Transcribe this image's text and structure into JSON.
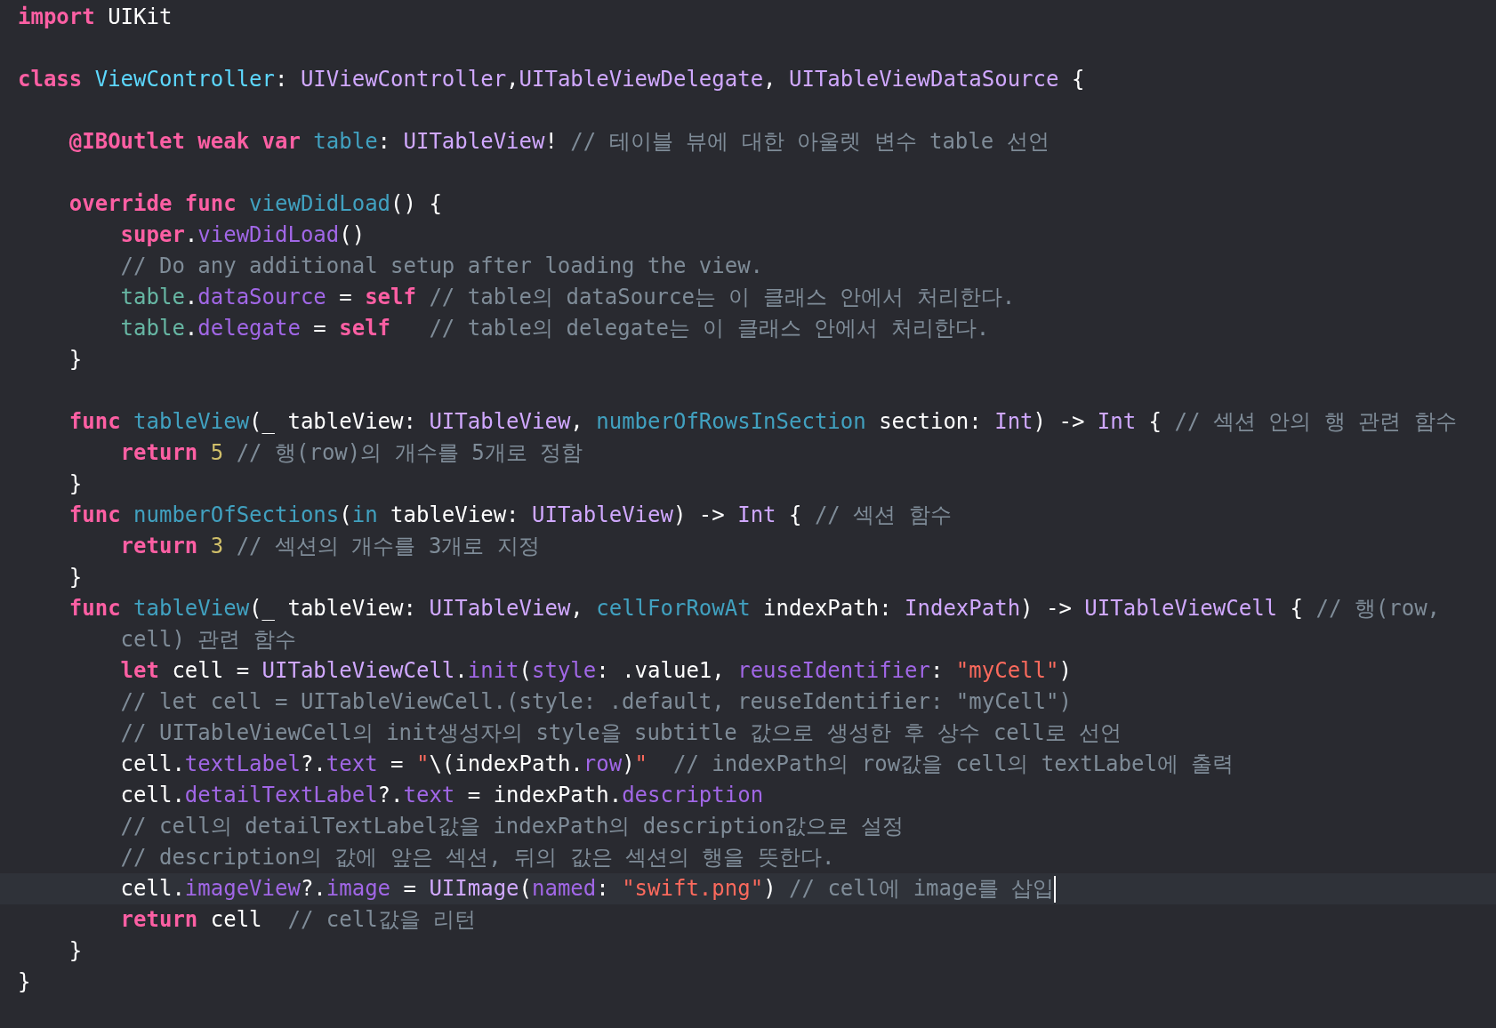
{
  "editor": {
    "lines": [
      {
        "current": false,
        "tokens": [
          {
            "kind": "keyword",
            "text": "import"
          },
          {
            "kind": "plain",
            "text": " UIKit"
          }
        ]
      },
      {
        "current": false
      },
      {
        "current": false,
        "tokens": [
          {
            "kind": "keyword",
            "text": "class"
          },
          {
            "kind": "class_decl",
            "text": " ViewController"
          },
          {
            "kind": "plain",
            "text": ": "
          },
          {
            "kind": "type",
            "text": "UIViewController"
          },
          {
            "kind": "plain",
            "text": ","
          },
          {
            "kind": "type",
            "text": "UITableViewDelegate"
          },
          {
            "kind": "plain",
            "text": ", "
          },
          {
            "kind": "type",
            "text": "UITableViewDataSource"
          },
          {
            "kind": "plain",
            "text": " {"
          }
        ]
      },
      {
        "current": false
      },
      {
        "current": false,
        "tokens": [
          {
            "kind": "keyword",
            "text": "    @IBOutlet weak var"
          },
          {
            "kind": "decl",
            "text": " table"
          },
          {
            "kind": "plain",
            "text": ": "
          },
          {
            "kind": "type",
            "text": "UITableView"
          },
          {
            "kind": "plain",
            "text": "! "
          },
          {
            "kind": "comment",
            "text": "// 테이블 뷰에 대한 아울렛 변수 table 선언"
          }
        ]
      },
      {
        "current": false
      },
      {
        "current": false,
        "tokens": [
          {
            "kind": "keyword",
            "text": "    override func"
          },
          {
            "kind": "decl",
            "text": " viewDidLoad"
          },
          {
            "kind": "plain",
            "text": "() {"
          }
        ]
      },
      {
        "current": false,
        "tokens": [
          {
            "kind": "keyword",
            "text": "        super"
          },
          {
            "kind": "plain",
            "text": "."
          },
          {
            "kind": "method",
            "text": "viewDidLoad"
          },
          {
            "kind": "plain",
            "text": "()"
          }
        ]
      },
      {
        "current": false,
        "tokens": [
          {
            "kind": "comment",
            "text": "        // Do any additional setup after loading the view."
          }
        ]
      },
      {
        "current": false,
        "tokens": [
          {
            "kind": "project",
            "text": "        table"
          },
          {
            "kind": "plain",
            "text": "."
          },
          {
            "kind": "method",
            "text": "dataSource"
          },
          {
            "kind": "plain",
            "text": " = "
          },
          {
            "kind": "keyword",
            "text": "self"
          },
          {
            "kind": "comment",
            "text": " // table의 dataSource는 이 클래스 안에서 처리한다."
          }
        ]
      },
      {
        "current": false,
        "tokens": [
          {
            "kind": "project",
            "text": "        table"
          },
          {
            "kind": "plain",
            "text": "."
          },
          {
            "kind": "method",
            "text": "delegate"
          },
          {
            "kind": "plain",
            "text": " = "
          },
          {
            "kind": "keyword",
            "text": "self"
          },
          {
            "kind": "comment",
            "text": "   // table의 delegate는 이 클래스 안에서 처리한다."
          }
        ]
      },
      {
        "current": false,
        "tokens": [
          {
            "kind": "plain",
            "text": "    }"
          }
        ]
      },
      {
        "current": false
      },
      {
        "current": false,
        "tokens": [
          {
            "kind": "keyword",
            "text": "    func"
          },
          {
            "kind": "decl",
            "text": " tableView"
          },
          {
            "kind": "plain",
            "text": "(_ tableView: "
          },
          {
            "kind": "type",
            "text": "UITableView"
          },
          {
            "kind": "plain",
            "text": ", "
          },
          {
            "kind": "decl",
            "text": "numberOfRowsInSection"
          },
          {
            "kind": "plain",
            "text": " section: "
          },
          {
            "kind": "type",
            "text": "Int"
          },
          {
            "kind": "plain",
            "text": ") -> "
          },
          {
            "kind": "type",
            "text": "Int"
          },
          {
            "kind": "plain",
            "text": " { "
          },
          {
            "kind": "comment",
            "text": "// 섹션 안의 행 관련 함수"
          }
        ]
      },
      {
        "current": false,
        "tokens": [
          {
            "kind": "keyword",
            "text": "        return"
          },
          {
            "kind": "number",
            "text": " 5"
          },
          {
            "kind": "comment",
            "text": " // 행(row)의 개수를 5개로 정함"
          }
        ]
      },
      {
        "current": false,
        "tokens": [
          {
            "kind": "plain",
            "text": "    }"
          }
        ]
      },
      {
        "current": false,
        "tokens": [
          {
            "kind": "keyword",
            "text": "    func"
          },
          {
            "kind": "decl",
            "text": " numberOfSections"
          },
          {
            "kind": "plain",
            "text": "("
          },
          {
            "kind": "decl",
            "text": "in"
          },
          {
            "kind": "plain",
            "text": " tableView: "
          },
          {
            "kind": "type",
            "text": "UITableView"
          },
          {
            "kind": "plain",
            "text": ") -> "
          },
          {
            "kind": "type",
            "text": "Int"
          },
          {
            "kind": "plain",
            "text": " { "
          },
          {
            "kind": "comment",
            "text": "// 섹션 함수"
          }
        ]
      },
      {
        "current": false,
        "tokens": [
          {
            "kind": "keyword",
            "text": "        return"
          },
          {
            "kind": "number",
            "text": " 3"
          },
          {
            "kind": "comment",
            "text": " // 섹션의 개수를 3개로 지정"
          }
        ]
      },
      {
        "current": false,
        "tokens": [
          {
            "kind": "plain",
            "text": "    }"
          }
        ]
      },
      {
        "current": false,
        "tokens": [
          {
            "kind": "keyword",
            "text": "    func"
          },
          {
            "kind": "decl",
            "text": " tableView"
          },
          {
            "kind": "plain",
            "text": "(_ tableView: "
          },
          {
            "kind": "type",
            "text": "UITableView"
          },
          {
            "kind": "plain",
            "text": ", "
          },
          {
            "kind": "decl",
            "text": "cellForRowAt"
          },
          {
            "kind": "plain",
            "text": " indexPath: "
          },
          {
            "kind": "type",
            "text": "IndexPath"
          },
          {
            "kind": "plain",
            "text": ") -> "
          },
          {
            "kind": "type",
            "text": "UITableViewCell"
          },
          {
            "kind": "plain",
            "text": " { "
          },
          {
            "kind": "comment",
            "text": "// 행(row,"
          }
        ]
      },
      {
        "current": false,
        "tokens": [
          {
            "kind": "comment",
            "text": "        cell) 관련 함수"
          }
        ]
      },
      {
        "current": false,
        "tokens": [
          {
            "kind": "keyword",
            "text": "        let"
          },
          {
            "kind": "plain",
            "text": " cell = "
          },
          {
            "kind": "type",
            "text": "UITableViewCell"
          },
          {
            "kind": "plain",
            "text": "."
          },
          {
            "kind": "method",
            "text": "init"
          },
          {
            "kind": "plain",
            "text": "("
          },
          {
            "kind": "method",
            "text": "style"
          },
          {
            "kind": "plain",
            "text": ": .value1, "
          },
          {
            "kind": "method",
            "text": "reuseIdentifier"
          },
          {
            "kind": "plain",
            "text": ": "
          },
          {
            "kind": "string",
            "text": "\"myCell\""
          },
          {
            "kind": "plain",
            "text": ")"
          }
        ]
      },
      {
        "current": false,
        "tokens": [
          {
            "kind": "comment",
            "text": "        // let cell = UITableViewCell.(style: .default, reuseIdentifier: \"myCell\")"
          }
        ]
      },
      {
        "current": false,
        "tokens": [
          {
            "kind": "comment",
            "text": "        // UITableViewCell의 init생성자의 style을 subtitle 값으로 생성한 후 상수 cell로 선언"
          }
        ]
      },
      {
        "current": false,
        "tokens": [
          {
            "kind": "plain",
            "text": "        cell."
          },
          {
            "kind": "method",
            "text": "textLabel"
          },
          {
            "kind": "plain",
            "text": "?."
          },
          {
            "kind": "method",
            "text": "text"
          },
          {
            "kind": "plain",
            "text": " = "
          },
          {
            "kind": "string",
            "text": "\""
          },
          {
            "kind": "plain",
            "text": "\\(indexPath."
          },
          {
            "kind": "method",
            "text": "row"
          },
          {
            "kind": "plain",
            "text": ")"
          },
          {
            "kind": "string",
            "text": "\""
          },
          {
            "kind": "comment",
            "text": "  // indexPath의 row값을 cell의 textLabel에 출력"
          }
        ]
      },
      {
        "current": false,
        "tokens": [
          {
            "kind": "plain",
            "text": "        cell."
          },
          {
            "kind": "method",
            "text": "detailTextLabel"
          },
          {
            "kind": "plain",
            "text": "?."
          },
          {
            "kind": "method",
            "text": "text"
          },
          {
            "kind": "plain",
            "text": " = indexPath."
          },
          {
            "kind": "method",
            "text": "description"
          }
        ]
      },
      {
        "current": false,
        "tokens": [
          {
            "kind": "comment",
            "text": "        // cell의 detailTextLabel값을 indexPath의 description값으로 설정"
          }
        ]
      },
      {
        "current": false,
        "tokens": [
          {
            "kind": "comment",
            "text": "        // description의 값에 앞은 섹션, 뒤의 값은 섹션의 행을 뜻한다."
          }
        ]
      },
      {
        "current": true,
        "tokens": [
          {
            "kind": "plain",
            "text": "        cell."
          },
          {
            "kind": "method",
            "text": "imageView"
          },
          {
            "kind": "plain",
            "text": "?."
          },
          {
            "kind": "method",
            "text": "image"
          },
          {
            "kind": "plain",
            "text": " = "
          },
          {
            "kind": "type",
            "text": "UIImage"
          },
          {
            "kind": "plain",
            "text": "("
          },
          {
            "kind": "method",
            "text": "named"
          },
          {
            "kind": "plain",
            "text": ": "
          },
          {
            "kind": "string",
            "text": "\"swift.png\""
          },
          {
            "kind": "plain",
            "text": ") "
          },
          {
            "kind": "comment",
            "text": "// cell에 image를 삽입"
          }
        ]
      },
      {
        "current": false,
        "tokens": [
          {
            "kind": "keyword",
            "text": "        return"
          },
          {
            "kind": "plain",
            "text": " cell"
          },
          {
            "kind": "comment",
            "text": "  // cell값을 리턴"
          }
        ]
      },
      {
        "current": false,
        "tokens": [
          {
            "kind": "plain",
            "text": "    }"
          }
        ]
      },
      {
        "current": false,
        "tokens": [
          {
            "kind": "plain",
            "text": "}"
          }
        ]
      }
    ]
  }
}
